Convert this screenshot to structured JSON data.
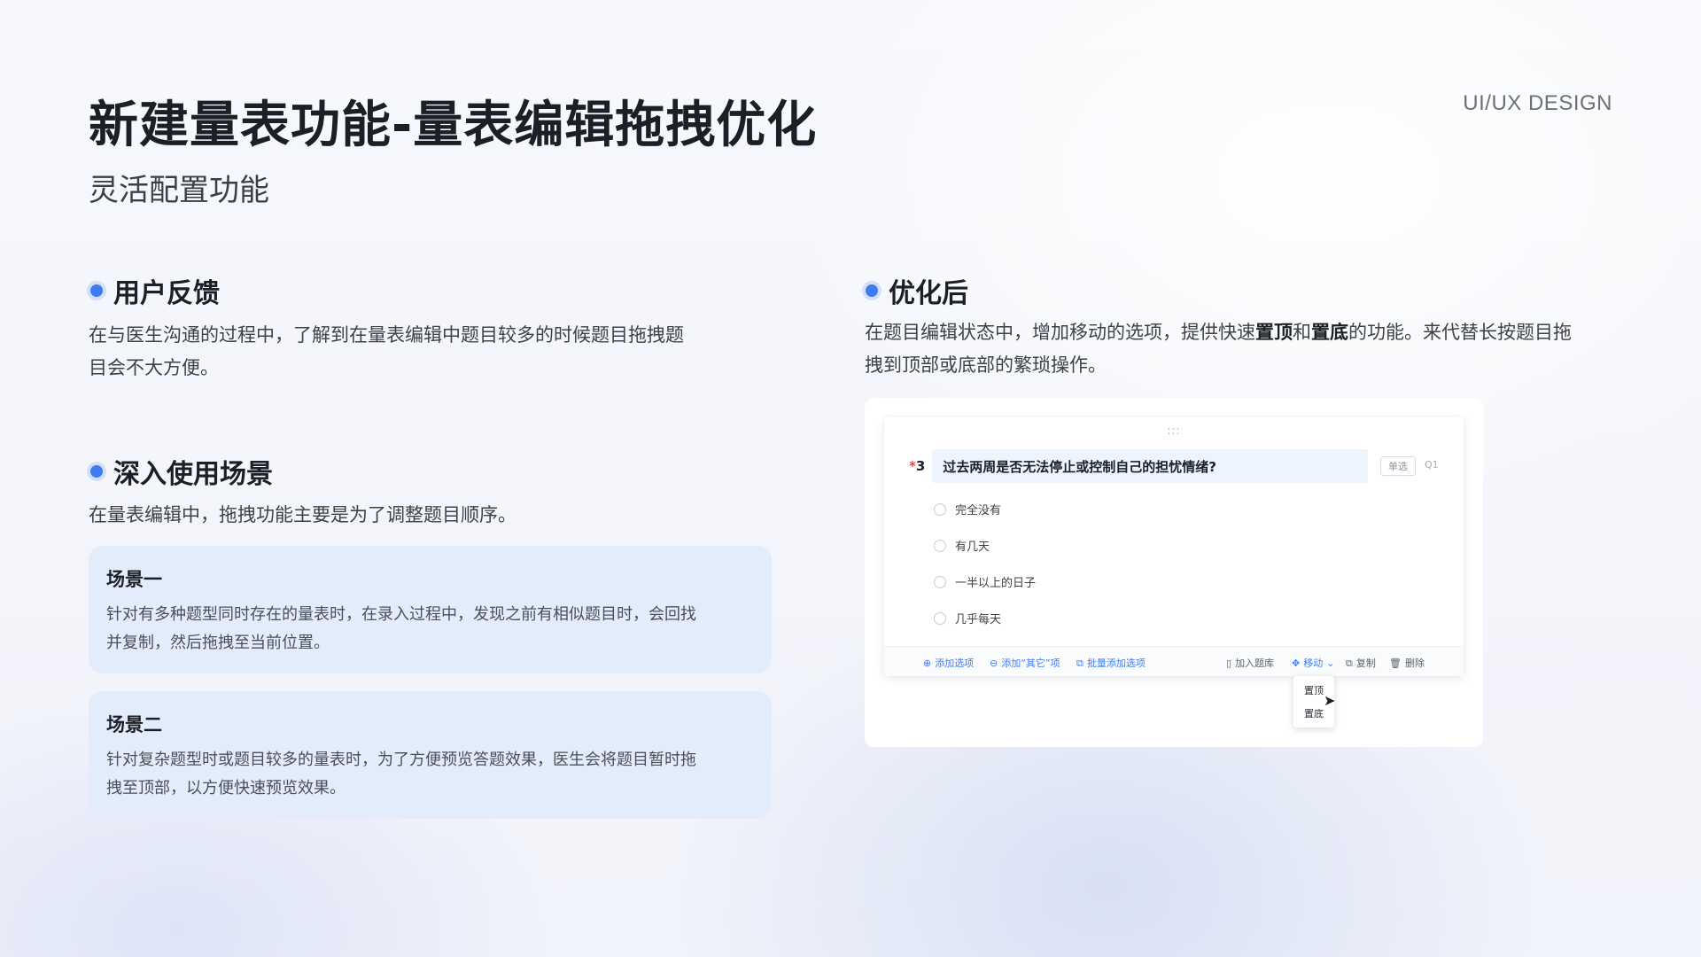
{
  "header": {
    "title": "新建量表功能-量表编辑拖拽优化",
    "subtitle": "灵活配置功能",
    "brand": "UI/UX DESIGN"
  },
  "feedback": {
    "heading": "用户反馈",
    "text_line1": "在与医生沟通的过程中，了解到在量表编辑中题目较多的时候题目拖拽题",
    "text_line2": "目会不大方便。"
  },
  "scenarios": {
    "heading": "深入使用场景",
    "intro": "在量表编辑中，拖拽功能主要是为了调整题目顺序。",
    "cards": [
      {
        "title": "场景一",
        "line1": "针对有多种题型同时存在的量表时，在录入过程中，发现之前有相似题目时，会回找",
        "line2": "并复制，然后拖拽至当前位置。"
      },
      {
        "title": "场景二",
        "line1": "针对复杂题型时或题目较多的量表时，为了方便预览答题效果，医生会将题目暂时拖",
        "line2": "拽至顶部，以方便快速预览效果。"
      }
    ]
  },
  "optimized": {
    "heading": "优化后",
    "text_pre": "在题目编辑状态中，增加移动的选项，提供快速",
    "text_bold1": "置顶",
    "text_mid": "和",
    "text_bold2": "置底",
    "text_post": "的功能。来代替长按题目拖",
    "text_line2": "拽到顶部或底部的繁琐操作。"
  },
  "editor": {
    "drag_handle": ":::",
    "required_mark": "*",
    "question_number": "3",
    "question_title": "过去两周是否无法停止或控制自己的担忧情绪?",
    "question_type": "单选",
    "question_id": "Q1",
    "options": [
      "完全没有",
      "有几天",
      "一半以上的日子",
      "几乎每天"
    ],
    "toolbar": {
      "add_option": "添加选项",
      "add_other": "添加“其它”项",
      "batch_add": "批量添加选项",
      "add_to_bank": "加入题库",
      "move": "移动",
      "copy": "复制",
      "delete": "删除"
    },
    "move_menu": [
      "置顶",
      "置底"
    ]
  },
  "colors": {
    "accent": "#3f7cf2",
    "card_bg": "#e3ecfb",
    "required": "#e04848"
  }
}
